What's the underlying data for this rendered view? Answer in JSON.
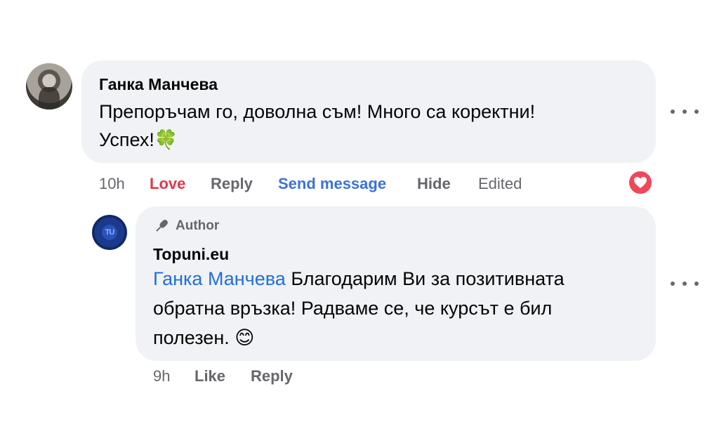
{
  "comment": {
    "author": "Ганка Манчева",
    "text_line1": "Препоръчам го, доволна съм! Много са коректни!",
    "text_line2": "Успех!",
    "emoji": "🍀",
    "actions": {
      "time": "10h",
      "love": "Love",
      "reply": "Reply",
      "send_message": "Send message",
      "hide": "Hide",
      "edited": "Edited"
    },
    "reaction_icon": "heart-icon"
  },
  "reply": {
    "badge_label": "Author",
    "badge_icon": "microphone-icon",
    "author": "Topuni.eu",
    "avatar_text": "TU",
    "mention": "Ганка Манчева",
    "text_line1_rest": " Благодарим Ви за позитивната",
    "text_line2": "обратна връзка! Радваме се, че курсът е бил",
    "text_line3": "полезен.",
    "emoji": "😊",
    "actions": {
      "time": "9h",
      "like": "Like",
      "reply": "Reply"
    }
  },
  "colors": {
    "bubble": "#f0f2f5",
    "love": "#e0374a",
    "link": "#3b72d9",
    "mention": "#216fdb",
    "muted": "#65676b"
  }
}
